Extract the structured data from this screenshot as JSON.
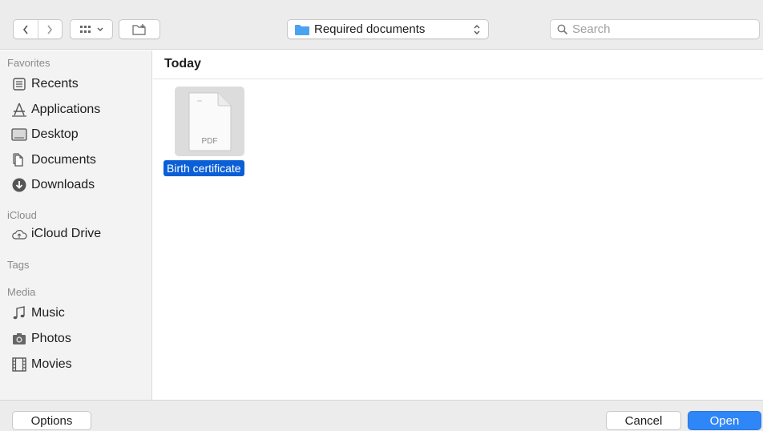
{
  "toolbar": {
    "location_label": "Required documents",
    "search_placeholder": "Search"
  },
  "sidebar": {
    "sections": {
      "favorites": "Favorites",
      "icloud": "iCloud",
      "tags": "Tags",
      "media": "Media"
    },
    "favorites": [
      {
        "label": "Recents",
        "icon": "recents-icon"
      },
      {
        "label": "Applications",
        "icon": "applications-icon"
      },
      {
        "label": "Desktop",
        "icon": "desktop-icon"
      },
      {
        "label": "Documents",
        "icon": "documents-icon"
      },
      {
        "label": "Downloads",
        "icon": "downloads-icon"
      }
    ],
    "icloud": [
      {
        "label": "iCloud Drive",
        "icon": "cloud-icon"
      }
    ],
    "media": [
      {
        "label": "Music",
        "icon": "music-icon"
      },
      {
        "label": "Photos",
        "icon": "camera-icon"
      },
      {
        "label": "Movies",
        "icon": "film-icon"
      }
    ]
  },
  "main": {
    "group_title": "Today",
    "files": [
      {
        "name": "Birth certificate",
        "type_badge": "PDF",
        "selected": true
      }
    ]
  },
  "footer": {
    "options_label": "Options",
    "cancel_label": "Cancel",
    "open_label": "Open"
  },
  "colors": {
    "selection": "#0a5fd7",
    "primary_button": "#2f86f6",
    "folder": "#4aa3f0"
  }
}
